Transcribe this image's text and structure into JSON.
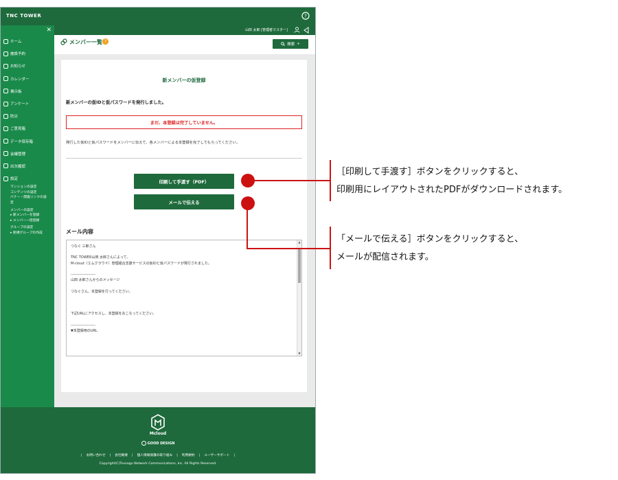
{
  "app": {
    "brand": "TNC TOWER"
  },
  "user": {
    "name": "山田 太郎 [管理者マスター]"
  },
  "sidebar": {
    "items": [
      {
        "label": "ホーム"
      },
      {
        "label": "施設予約"
      },
      {
        "label": "お知らせ"
      },
      {
        "label": "カレンダー"
      },
      {
        "label": "掲示板"
      },
      {
        "label": "アンケート"
      },
      {
        "label": "防災"
      },
      {
        "label": "ご意見箱"
      },
      {
        "label": "データ保存箱"
      },
      {
        "label": "会議管理"
      },
      {
        "label": "出欠確認"
      },
      {
        "label": "設定"
      }
    ],
    "sub_items": [
      "マンションの設定",
      "コンテンツの設定",
      "バナー・関連リンクの設",
      "定",
      "メンバーの設定",
      "▸ 新メンバーを登録",
      "▸ メンバー一括登録",
      "グループの設定",
      "▸ 新規グループの作成"
    ]
  },
  "page": {
    "title": "メンバー一覧",
    "search_label": "検索",
    "search_plus": "+"
  },
  "main": {
    "heading": "新メンバーの仮登録",
    "issued_message": "新メンバーの仮IDと仮パスワードを発行しました。",
    "warning": "まだ、本登録は完了していません。",
    "instruction": "発行した仮IDと仮パスワードをメンバーに伝えて、各メンバーによる本登録を完了してもらってください。",
    "print_button": "印刷して手渡す（PDF）",
    "mail_button": "メールで伝える",
    "mail_heading": "メール内容",
    "mail_lines": [
      "つなぐ 三郎さん",
      "",
      "TNC TOWER山田 太郎さんによって、",
      "M-cloud（エムクラウド）管理組合支援サービスの仮IDと仮パスワードが発行されました。",
      "",
      "--------------------",
      "山田 太郎さんからのメッセージ",
      "",
      "つなぐさん、本登録を行ってください。",
      "",
      "",
      "",
      "下記URLにアクセスし、本登録をおこなってください。",
      "",
      "--------------------",
      "▼本登録用のURL"
    ]
  },
  "footer": {
    "logo_text": "Mcloud",
    "good_design": "GOOD DESIGN",
    "links": [
      "お問い合わせ",
      "会社概要",
      "個人情報保護の取り組み",
      "利用規約",
      "ユーザーサポート"
    ],
    "copyright": "Copyright(C)Tsunagu Network Communications, Inc. All Rights Reserved."
  },
  "callouts": {
    "print": [
      "［印刷して手渡す］ボタンをクリックすると、",
      "印刷用にレイアウトされたPDFがダウンロードされます。"
    ],
    "mail": [
      "「メールで伝える］ボタンをクリックすると、",
      "メールが配信されます。"
    ]
  },
  "colors": {
    "primary_green": "#1e6a3c",
    "sidebar_green": "#1a8a4a",
    "warning_red": "#dd2222",
    "callout_red": "#cc1111"
  }
}
